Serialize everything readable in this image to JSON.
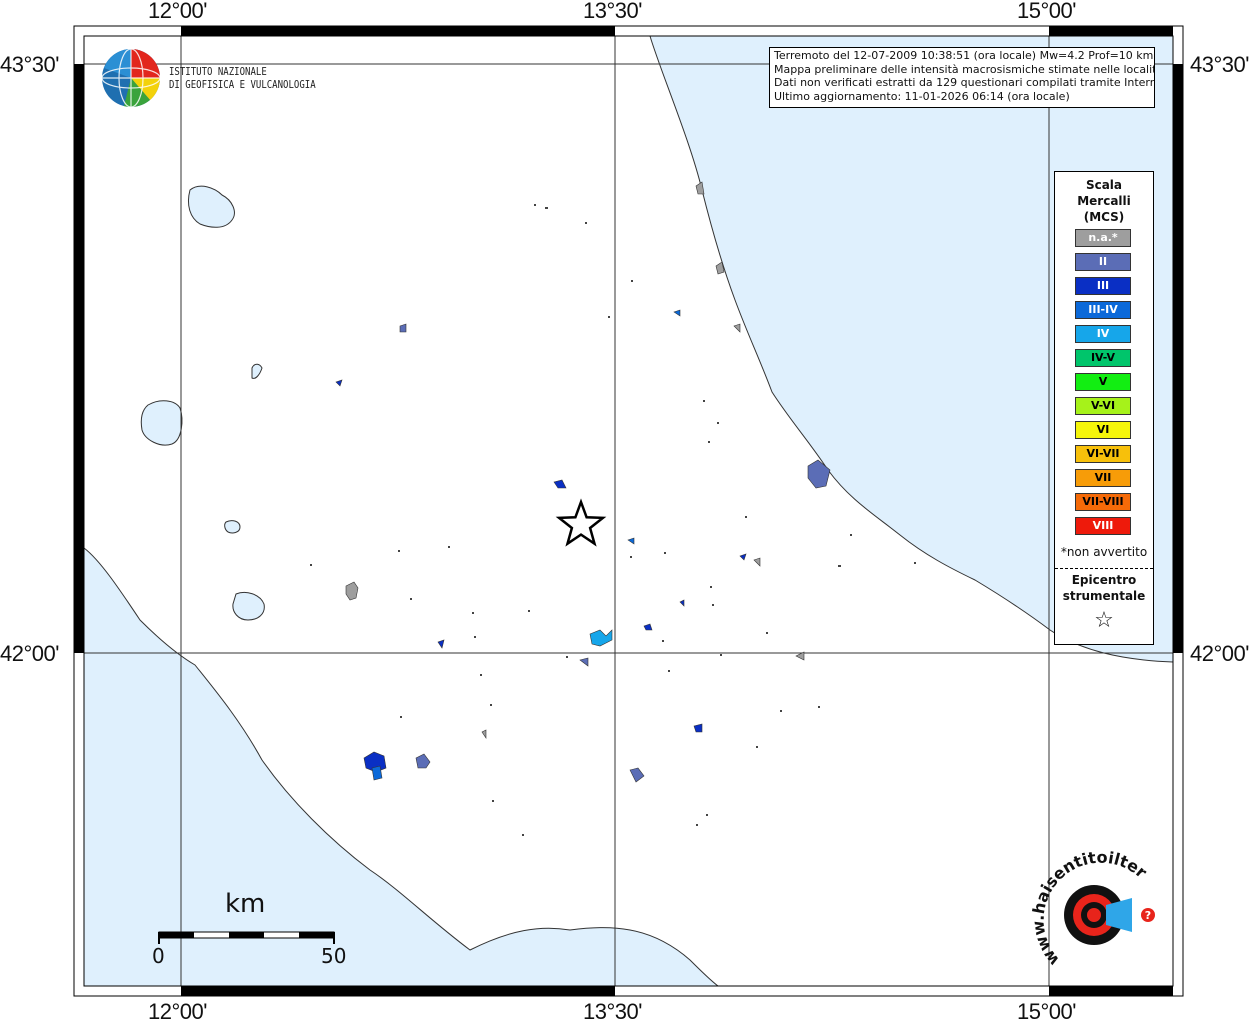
{
  "map": {
    "coords": {
      "top": [
        "12°00'",
        "13°30'",
        "15°00'"
      ],
      "bottom": [
        "12°00'",
        "13°30'",
        "15°00'"
      ],
      "left": [
        "43°30'",
        "42°00'"
      ],
      "right": [
        "43°30'",
        "42°00'"
      ]
    },
    "logo": {
      "line1": "ISTITUTO NAZIONALE",
      "line2": "DI GEOFISICA E VULCANOLOGIA"
    },
    "info_lines": [
      "Terremoto del 12-07-2009 10:38:51 (ora locale) Mw=4.2 Prof=10 km",
      "Mappa preliminare delle intensità macrosismiche stimate nelle località",
      "Dati non verificati estratti da 129 questionari compilati tramite Internet.",
      "Ultimo aggiornamento: 11-01-2026 06:14 (ora locale)"
    ],
    "legend": {
      "title_lines": [
        "Scala",
        "Mercalli",
        "(MCS)"
      ],
      "items": [
        {
          "label": "n.a.*",
          "color": "#9e9e9e",
          "text_color": "#ffffff"
        },
        {
          "label": "II",
          "color": "#5b6db6",
          "text_color": "#ffffff"
        },
        {
          "label": "III",
          "color": "#0a2fc4",
          "text_color": "#ffffff"
        },
        {
          "label": "III-IV",
          "color": "#0b69d9",
          "text_color": "#ffffff"
        },
        {
          "label": "IV",
          "color": "#16a6ea",
          "text_color": "#ffffff"
        },
        {
          "label": "IV-V",
          "color": "#00c56b",
          "text_color": "#000000"
        },
        {
          "label": "V",
          "color": "#12ee12",
          "text_color": "#000000"
        },
        {
          "label": "V-VI",
          "color": "#a6f21a",
          "text_color": "#000000"
        },
        {
          "label": "VI",
          "color": "#f5f50a",
          "text_color": "#000000"
        },
        {
          "label": "VI-VII",
          "color": "#f7c00b",
          "text_color": "#000000"
        },
        {
          "label": "VII",
          "color": "#f79c08",
          "text_color": "#000000"
        },
        {
          "label": "VII-VIII",
          "color": "#f56a08",
          "text_color": "#000000"
        },
        {
          "label": "VIII",
          "color": "#ee1a0b",
          "text_color": "#ffffff"
        }
      ],
      "note": "*non avvertito",
      "epicenter_lines": [
        "Epicentro",
        "strumentale"
      ],
      "epicenter_symbol": "☆"
    },
    "scalebar": {
      "title": "km",
      "min": "0",
      "max": "50"
    },
    "haisentito_logo": "www.haisentitoilterremoto.it",
    "colors": {
      "sea": "#dff0fd",
      "land": "#ffffff",
      "frame": "#000000"
    }
  }
}
